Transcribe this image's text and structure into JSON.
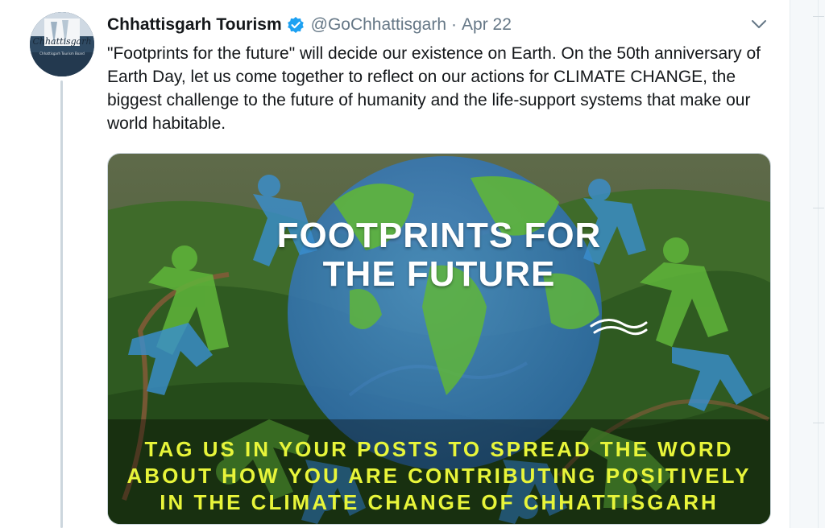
{
  "tweet": {
    "display_name": "Chhattisgarh Tourism",
    "handle": "@GoChhattisgarh",
    "separator": "·",
    "date": "Apr 22",
    "text": "\"Footprints for the future\" will decide our existence on Earth. On the 50th anniversary of Earth Day, let us come together to reflect on our actions for CLIMATE CHANGE, the biggest challenge to the future of humanity and the life-support systems that make our world habitable.",
    "avatar_text": "Chhattisgarh",
    "avatar_subtext": "Chhattisgarh Tourism Board"
  },
  "media": {
    "headline_line1": "FOOTPRINTS FOR",
    "headline_line2": "THE FUTURE",
    "caption_line1": "TAG US IN YOUR POSTS TO SPREAD THE WORD",
    "caption_line2": "ABOUT HOW YOU ARE CONTRIBUTING POSITIVELY",
    "caption_line3": "IN THE CLIMATE CHANGE OF CHHATTISGARH"
  },
  "icons": {
    "verified": "verified-badge-icon",
    "caret": "chevron-down-icon"
  },
  "colors": {
    "verified_blue": "#1da1f2",
    "caption_yellow": "#e8f53a",
    "secondary_text": "#657786"
  }
}
